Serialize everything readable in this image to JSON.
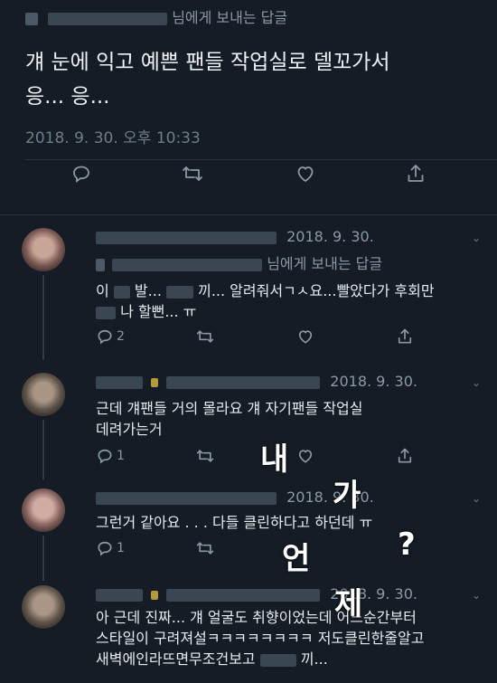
{
  "main_tweet": {
    "reply_suffix": "님에게 보내는 답글",
    "lines": [
      "걔 눈에 익고 예쁜 팬들 작업실로 델꼬가서",
      "응... 응..."
    ],
    "timestamp": "2018. 9. 30. 오후 10:33"
  },
  "replies": [
    {
      "date": "2018. 9. 30.",
      "reply_suffix": "님에게 보내는 답글",
      "line1_a": "이",
      "line1_b": "발...",
      "line1_c": "끼... 알려줘서ㄱㅅ요...빨았다가 후회만",
      "line2": "나 할뻔... ㅠ",
      "reply_count": "2"
    },
    {
      "date": "2018. 9. 30.",
      "line1": "근데 걔팬들 거의 몰라요 걔 자기팬들 작업실",
      "line2": "데려가는거",
      "reply_count": "1"
    },
    {
      "date": "2018. 9. 30.",
      "line1": "그런거 같아요 . . .  다들 클린하다고 하던데 ㅠ",
      "reply_count": "1"
    },
    {
      "date": "2018. 9. 30.",
      "line1": "아 근데 진짜... 걔 얼굴도 취향이었는데 어느순간부터",
      "line2": "스타일이 구려져설ㅋㅋㅋㅋㅋㅋㅋㅋ 저도클린한줄알고",
      "line3": "새벽에인라뜨면무조건보고",
      "line3_end": "끼..."
    }
  ],
  "overlay": {
    "w1": "내",
    "w2": "가",
    "w3": "언",
    "w4": "제",
    "w5": "?"
  },
  "icons": [
    "reply-icon",
    "retweet-icon",
    "like-icon",
    "share-icon",
    "chevron-down-icon"
  ]
}
